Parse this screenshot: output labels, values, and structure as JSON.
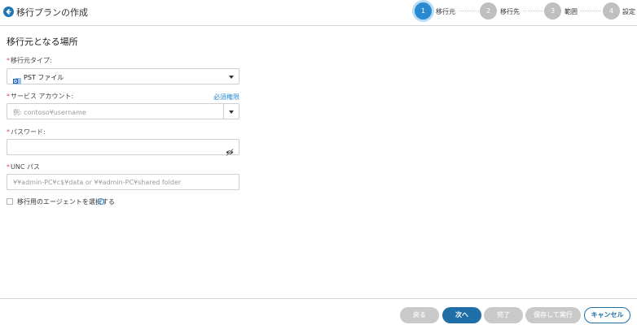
{
  "header": {
    "title": "移行プランの作成",
    "steps": [
      {
        "number": "1",
        "label": "移行元",
        "active": true
      },
      {
        "number": "2",
        "label": "移行先",
        "active": false
      },
      {
        "number": "3",
        "label": "範囲",
        "active": false
      },
      {
        "number": "4",
        "label": "設定",
        "active": false
      }
    ]
  },
  "main": {
    "section_title": "移行元となる場所",
    "source_type": {
      "required_mark": "*",
      "label": "移行元タイプ:",
      "value": "PST ファイル",
      "icon": "outlook-pst-icon"
    },
    "service_account": {
      "required_mark": "*",
      "label": "サービス アカウント:",
      "placeholder": "例: contoso¥username",
      "link": "必須権限"
    },
    "password": {
      "required_mark": "*",
      "label": "パスワード:",
      "value": "",
      "icon": "eye-slash-icon"
    },
    "unc_path": {
      "required_mark": "*",
      "label": "UNC パス",
      "placeholder": "¥¥admin-PC¥c$¥data or ¥¥admin-PC¥shared folder"
    },
    "agent_checkbox": {
      "label": "移行用のエージェントを選択する",
      "checked": false,
      "icon": "info-icon"
    }
  },
  "footer": {
    "back": "戻る",
    "next": "次へ",
    "finish": "完了",
    "save_run": "保存して実行",
    "cancel": "キャンセル"
  },
  "colors": {
    "accent": "#2a89d0",
    "primary_button": "#1f6ea8",
    "disabled_button": "#c9c9c9",
    "required": "#d9534f"
  }
}
